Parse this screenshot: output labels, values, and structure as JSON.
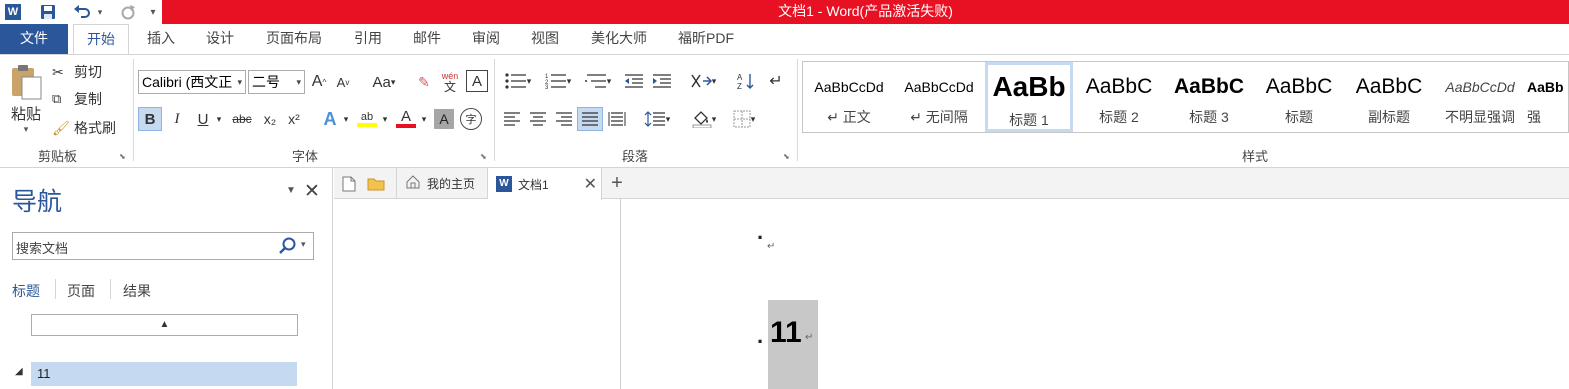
{
  "title_bar": {
    "title": "文档1 -  Word(产品激活失败)",
    "accent": "#e81123"
  },
  "quick_access": {
    "word_icon": "W",
    "more": "▾"
  },
  "ribbon_tabs": [
    "文件",
    "开始",
    "插入",
    "设计",
    "页面布局",
    "引用",
    "邮件",
    "审阅",
    "视图",
    "美化大师",
    "福昕PDF"
  ],
  "clipboard": {
    "paste": "粘贴",
    "cut": "剪切",
    "copy": "复制",
    "format_painter": "格式刷",
    "group": "剪贴板"
  },
  "font": {
    "name": "Calibri (西文正",
    "size": "二号",
    "group": "字体",
    "grow": "A",
    "shrink": "A",
    "case": "Aa",
    "bold": "B",
    "italic": "I",
    "underline": "U",
    "strike": "abc",
    "sub": "x₂",
    "sup": "x²",
    "phonetic_top": "wén",
    "phonetic_bottom": "文",
    "border_char": "A",
    "effects": "A",
    "highlight": "ab",
    "color": "A",
    "shading": "A",
    "enclose": "字"
  },
  "paragraph": {
    "group": "段落"
  },
  "styles": {
    "group": "样式",
    "items": [
      {
        "preview": "AaBbCcDd",
        "label": "↵ 正文"
      },
      {
        "preview": "AaBbCcDd",
        "label": "↵ 无间隔"
      },
      {
        "preview": "AaBb",
        "label": "标题 1"
      },
      {
        "preview": "AaBbC",
        "label": "标题 2"
      },
      {
        "preview": "AaBbC",
        "label": "标题 3"
      },
      {
        "preview": "AaBbC",
        "label": "标题"
      },
      {
        "preview": "AaBbC",
        "label": "副标题"
      },
      {
        "preview": "AaBbCcDd",
        "label": "不明显强调"
      },
      {
        "preview": "AaBb",
        "label": "强"
      }
    ]
  },
  "navigation": {
    "title": "导航",
    "search_placeholder": "搜索文档",
    "tabs": [
      "标题",
      "页面",
      "结果"
    ],
    "heading_item": "11"
  },
  "doc_tabs": {
    "home": "我的主页",
    "doc": "文档1",
    "add": "+"
  },
  "document": {
    "bullet1": ".",
    "heading_text": "11",
    "para_mark": "↵"
  }
}
